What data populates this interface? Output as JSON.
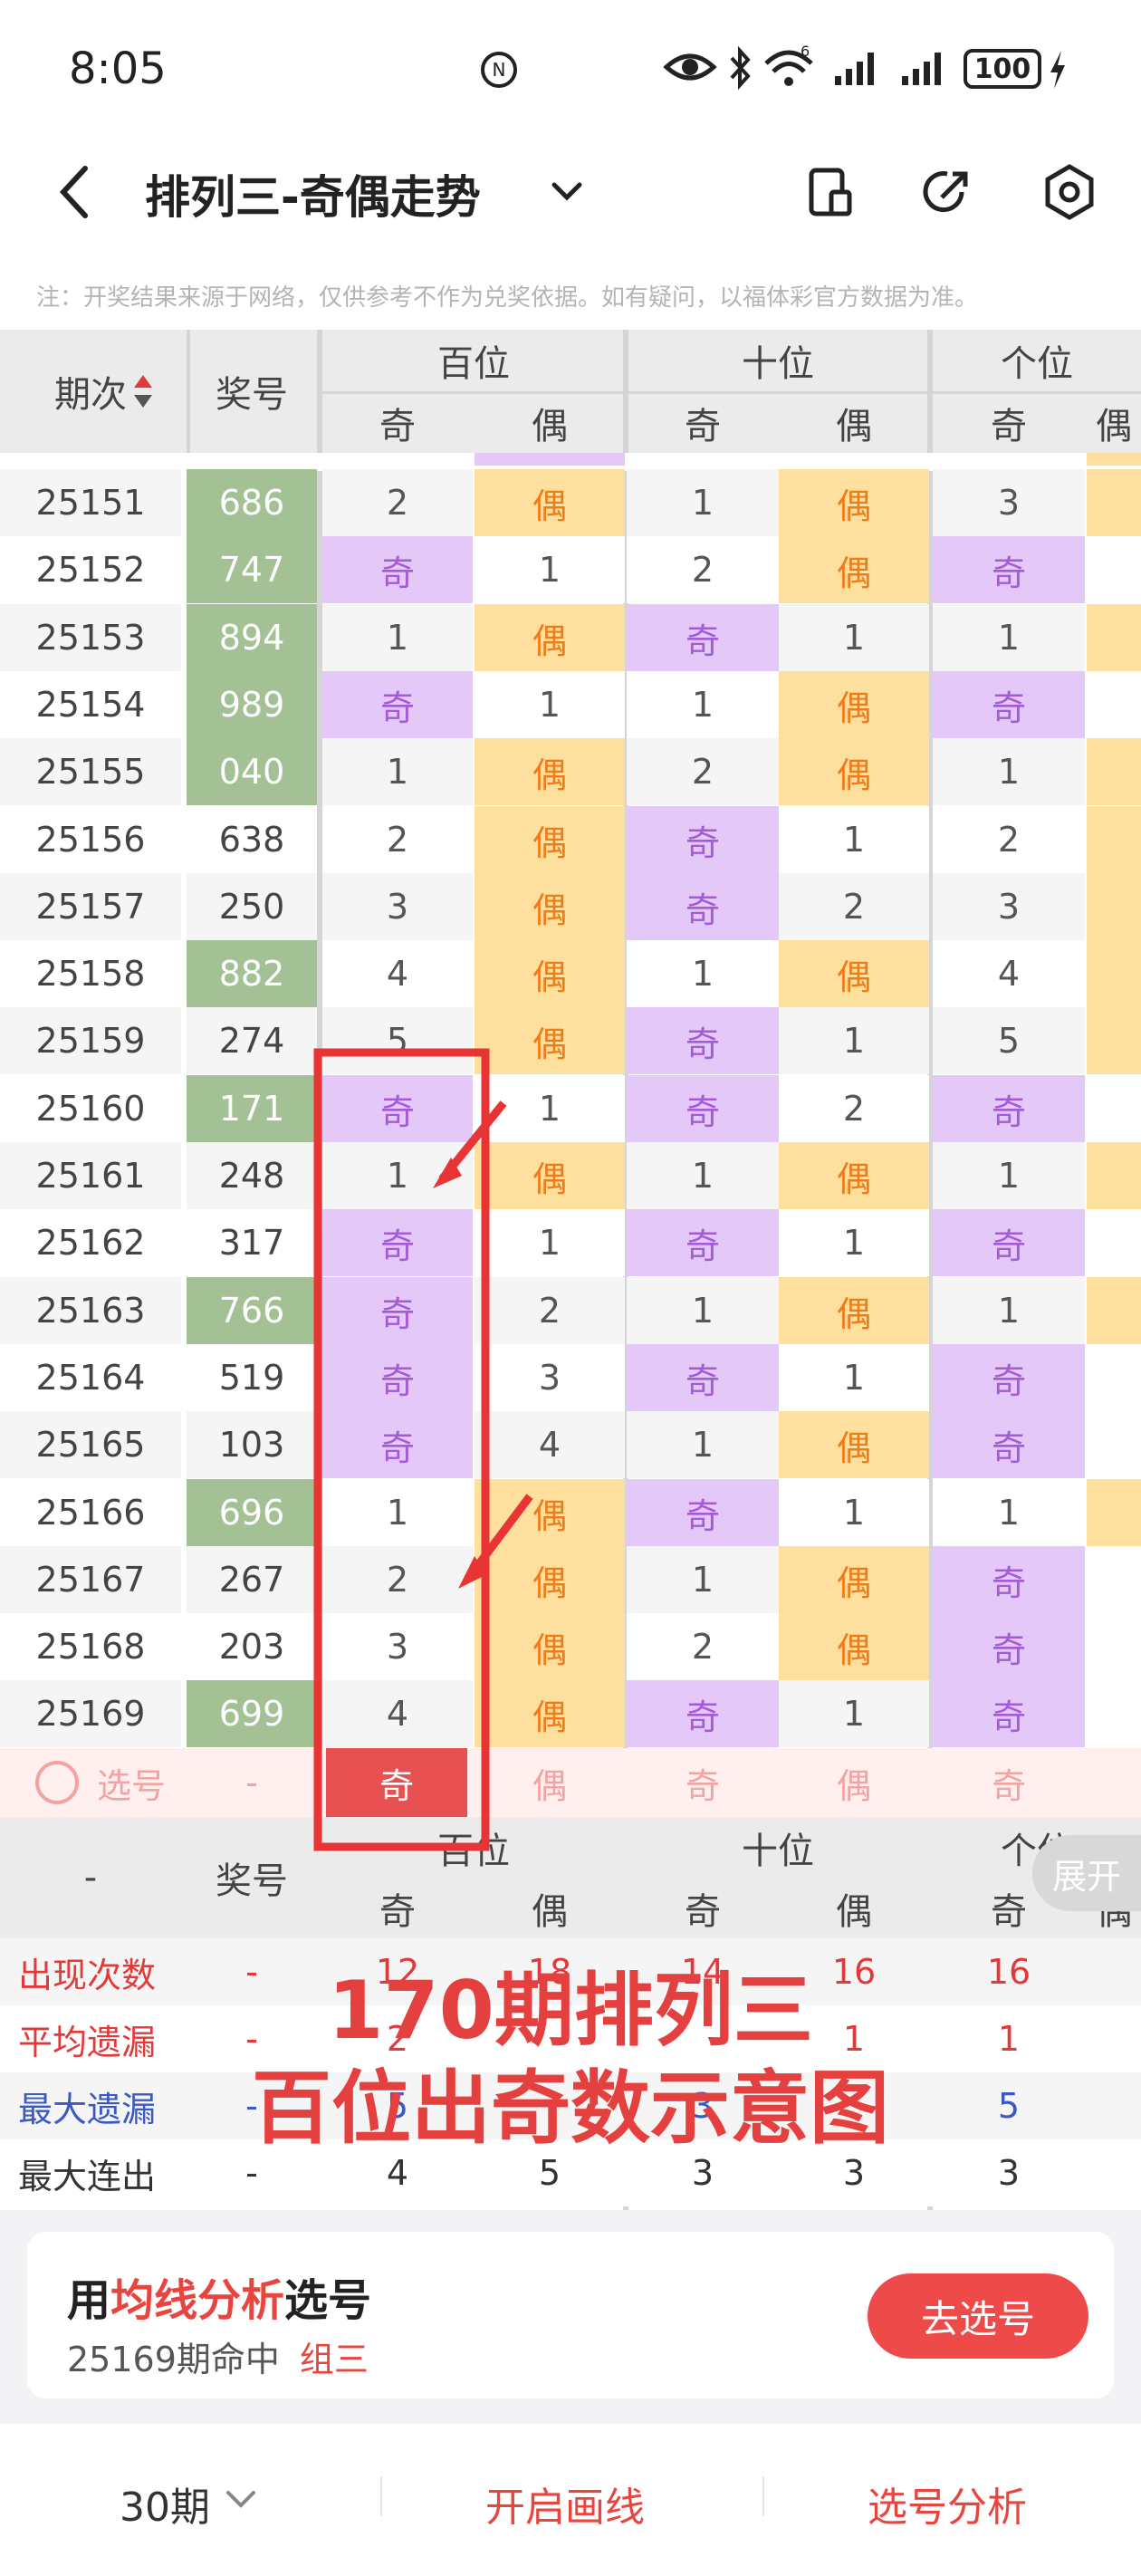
{
  "status": {
    "time": "8:05",
    "battery": "100",
    "signal": "6"
  },
  "nav": {
    "title": "排列三-奇偶走势"
  },
  "notice": "注：开奖结果来源于网络，仅供参考不作为兑奖依据。如有疑问，以福体彩官方数据为准。",
  "header": {
    "period": "期次",
    "number": "奖号",
    "groups": [
      "百位",
      "十位",
      "个位"
    ],
    "odd": "奇",
    "even": "偶"
  },
  "rows": [
    {
      "period": "25151",
      "number": "686",
      "hl": true,
      "cells": [
        "2",
        "偶",
        "1",
        "偶",
        "3"
      ]
    },
    {
      "period": "25152",
      "number": "747",
      "hl": true,
      "cells": [
        "奇",
        "1",
        "2",
        "偶",
        "奇"
      ]
    },
    {
      "period": "25153",
      "number": "894",
      "hl": true,
      "cells": [
        "1",
        "偶",
        "奇",
        "1",
        "1"
      ]
    },
    {
      "period": "25154",
      "number": "989",
      "hl": true,
      "cells": [
        "奇",
        "1",
        "1",
        "偶",
        "奇"
      ]
    },
    {
      "period": "25155",
      "number": "040",
      "hl": true,
      "cells": [
        "1",
        "偶",
        "2",
        "偶",
        "1"
      ]
    },
    {
      "period": "25156",
      "number": "638",
      "hl": false,
      "cells": [
        "2",
        "偶",
        "奇",
        "1",
        "2"
      ]
    },
    {
      "period": "25157",
      "number": "250",
      "hl": false,
      "cells": [
        "3",
        "偶",
        "奇",
        "2",
        "3"
      ]
    },
    {
      "period": "25158",
      "number": "882",
      "hl": true,
      "cells": [
        "4",
        "偶",
        "1",
        "偶",
        "4"
      ]
    },
    {
      "period": "25159",
      "number": "274",
      "hl": false,
      "cells": [
        "5",
        "偶",
        "奇",
        "1",
        "5"
      ]
    },
    {
      "period": "25160",
      "number": "171",
      "hl": true,
      "cells": [
        "奇",
        "1",
        "奇",
        "2",
        "奇"
      ]
    },
    {
      "period": "25161",
      "number": "248",
      "hl": false,
      "cells": [
        "1",
        "偶",
        "1",
        "偶",
        "1"
      ]
    },
    {
      "period": "25162",
      "number": "317",
      "hl": false,
      "cells": [
        "奇",
        "1",
        "奇",
        "1",
        "奇"
      ]
    },
    {
      "period": "25163",
      "number": "766",
      "hl": true,
      "cells": [
        "奇",
        "2",
        "1",
        "偶",
        "1"
      ]
    },
    {
      "period": "25164",
      "number": "519",
      "hl": false,
      "cells": [
        "奇",
        "3",
        "奇",
        "1",
        "奇"
      ]
    },
    {
      "period": "25165",
      "number": "103",
      "hl": false,
      "cells": [
        "奇",
        "4",
        "1",
        "偶",
        "奇"
      ]
    },
    {
      "period": "25166",
      "number": "696",
      "hl": true,
      "cells": [
        "1",
        "偶",
        "奇",
        "1",
        "1"
      ]
    },
    {
      "period": "25167",
      "number": "267",
      "hl": false,
      "cells": [
        "2",
        "偶",
        "1",
        "偶",
        "奇"
      ]
    },
    {
      "period": "25168",
      "number": "203",
      "hl": false,
      "cells": [
        "3",
        "偶",
        "2",
        "偶",
        "奇"
      ]
    },
    {
      "period": "25169",
      "number": "699",
      "hl": true,
      "cells": [
        "4",
        "偶",
        "奇",
        "1",
        "奇"
      ]
    }
  ],
  "select_row": {
    "label": "选号",
    "number": "-",
    "cells": [
      "奇",
      "偶",
      "奇",
      "偶",
      "奇"
    ]
  },
  "expand_label": "展开",
  "stats": [
    {
      "label": "出现次数",
      "color": "#e23a3a",
      "dash": "-",
      "values": [
        "12",
        "18",
        "14",
        "16",
        "16"
      ]
    },
    {
      "label": "平均遗漏",
      "color": "#e23a3a",
      "dash": "-",
      "values": [
        "2",
        "",
        "",
        "1",
        "1"
      ]
    },
    {
      "label": "最大遗漏",
      "color": "#3a59c4",
      "dash": "-",
      "values": [
        "5",
        "",
        "3",
        "",
        "5"
      ]
    },
    {
      "label": "最大连出",
      "color": "#333333",
      "dash": "-",
      "values": [
        "4",
        "5",
        "3",
        "3",
        "3"
      ]
    }
  ],
  "stats_header_dash": "-",
  "card": {
    "prefix": "用",
    "highlight": "均线分析",
    "suffix": "选号",
    "hit_text": "25169期命中",
    "hit_type": "组三",
    "button": "去选号"
  },
  "bottom": {
    "periods": "30期",
    "draw": "开启画线",
    "analysis": "选号分析"
  },
  "overlay": {
    "line1": "170期排列三",
    "line2": "百位出奇数示意图"
  }
}
